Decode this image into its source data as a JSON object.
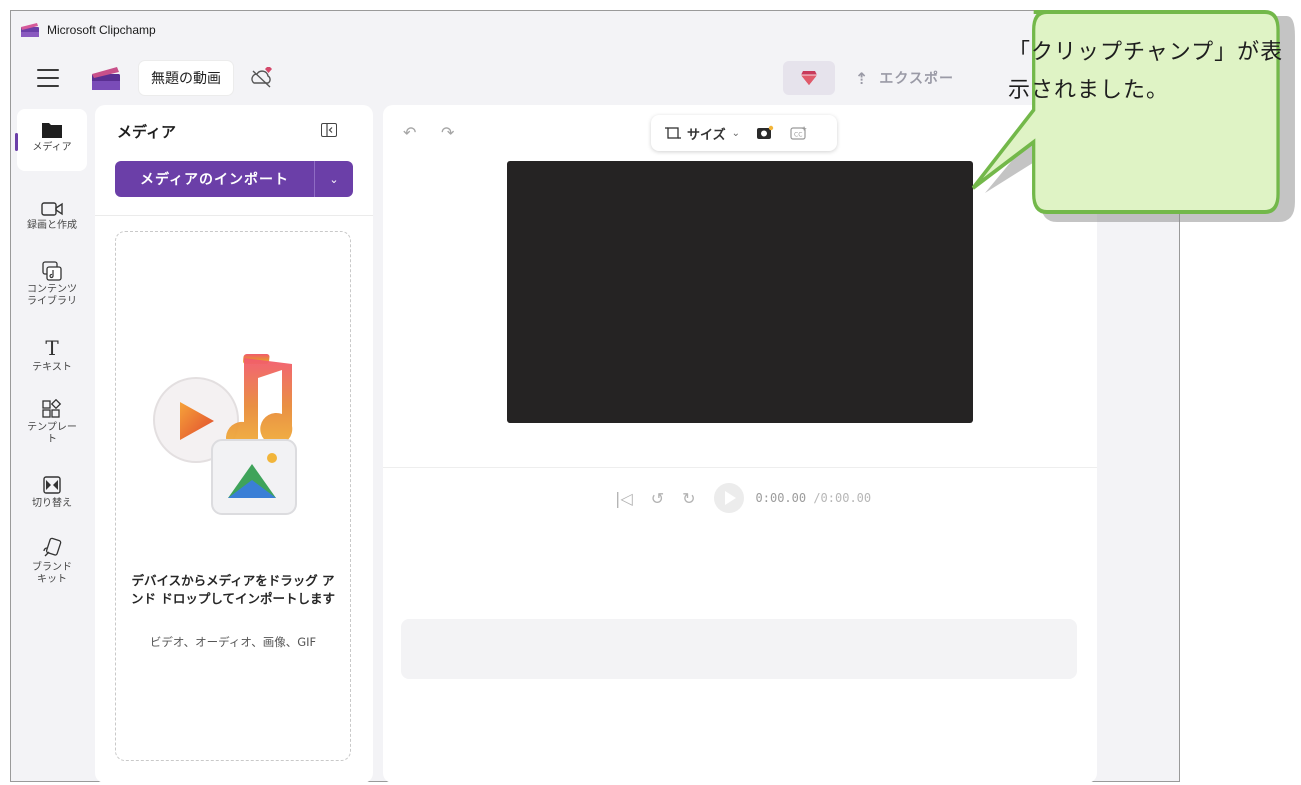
{
  "window": {
    "title": "Microsoft Clipchamp"
  },
  "topbar": {
    "project_title": "無題の動画",
    "export_label": "エクスポー"
  },
  "nav": {
    "items": [
      {
        "label": "メディア",
        "icon": "folder-icon",
        "active": true
      },
      {
        "label": "録画と作成",
        "icon": "video-camera-icon"
      },
      {
        "label": "コンテンツ\nライブラリ",
        "icon": "content-library-icon"
      },
      {
        "label": "テキスト",
        "icon": "text-icon"
      },
      {
        "label": "テンプレー\nト",
        "icon": "templates-icon"
      },
      {
        "label": "切り替え",
        "icon": "transitions-icon"
      },
      {
        "label": "ブランド\nキット",
        "icon": "brand-kit-icon"
      }
    ]
  },
  "media": {
    "title": "メディア",
    "import_label": "メディアのインポート",
    "drop_text": "デバイスからメディアをドラッグ アンド ドロップしてインポートします",
    "drop_sub": "ビデオ、オーディオ、画像、GIF"
  },
  "stage": {
    "size_label": "サイズ",
    "time_current": "0:00.00",
    "time_total": "/0:00.00"
  },
  "callout": {
    "text": "「クリップチャンプ」が表示されました。"
  },
  "colors": {
    "accent": "#6b3fa8",
    "canvas": "#252323",
    "callout_fill": "#dff3c5",
    "callout_border": "#73b84a"
  }
}
